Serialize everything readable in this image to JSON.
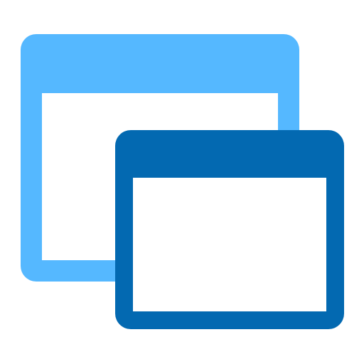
{
  "icon": {
    "name": "multiple-windows-icon",
    "back_window": {
      "frame_color": "#55B8FF",
      "pane_color": "#FFFFFF"
    },
    "front_window": {
      "frame_color": "#0369B1",
      "pane_color": "#FFFFFF"
    }
  }
}
